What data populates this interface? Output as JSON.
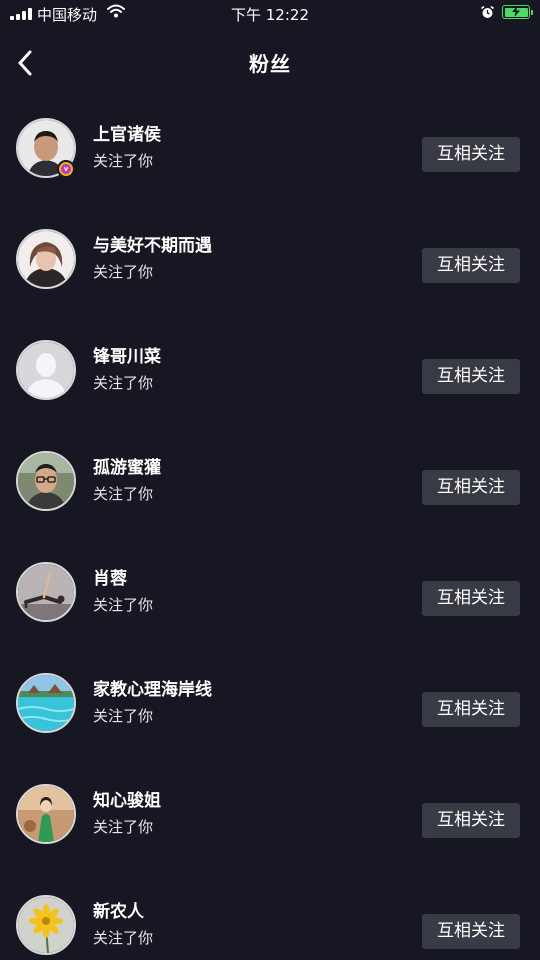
{
  "status_bar": {
    "carrier": "中国移动",
    "time": "下午 12:22",
    "battery_level": 1.0,
    "icons": [
      "signal-icon",
      "wifi-icon",
      "alarm-icon",
      "battery-charging-icon"
    ]
  },
  "header": {
    "title": "粉丝",
    "back_icon": "chevron-left-icon"
  },
  "fans": [
    {
      "name": "上官诸侯",
      "subtitle": "关注了你",
      "button": "互相关注",
      "verified": true,
      "avatar": "man-portrait"
    },
    {
      "name": "与美好不期而遇",
      "subtitle": "关注了你",
      "button": "互相关注",
      "verified": false,
      "avatar": "woman-portrait"
    },
    {
      "name": "锋哥川菜",
      "subtitle": "关注了你",
      "button": "互相关注",
      "verified": false,
      "avatar": "default-silhouette"
    },
    {
      "name": "孤游蜜獾",
      "subtitle": "关注了你",
      "button": "互相关注",
      "verified": false,
      "avatar": "man-glasses-portrait"
    },
    {
      "name": "肖蓉",
      "subtitle": "关注了你",
      "button": "互相关注",
      "verified": false,
      "avatar": "yoga-pose"
    },
    {
      "name": "家教心理海岸线",
      "subtitle": "关注了你",
      "button": "互相关注",
      "verified": false,
      "avatar": "beach-pool"
    },
    {
      "name": "知心骏姐",
      "subtitle": "关注了你",
      "button": "互相关注",
      "verified": false,
      "avatar": "woman-green-dress"
    },
    {
      "name": "新农人",
      "subtitle": "关注了你",
      "button": "互相关注",
      "verified": false,
      "avatar": "yellow-flower"
    }
  ],
  "colors": {
    "background": "#161722",
    "button_bg": "#393b44",
    "text_primary": "#ffffff",
    "battery": "#4cd964",
    "verified_outer": "#f5b400",
    "verified_inner": "#c234c9"
  }
}
